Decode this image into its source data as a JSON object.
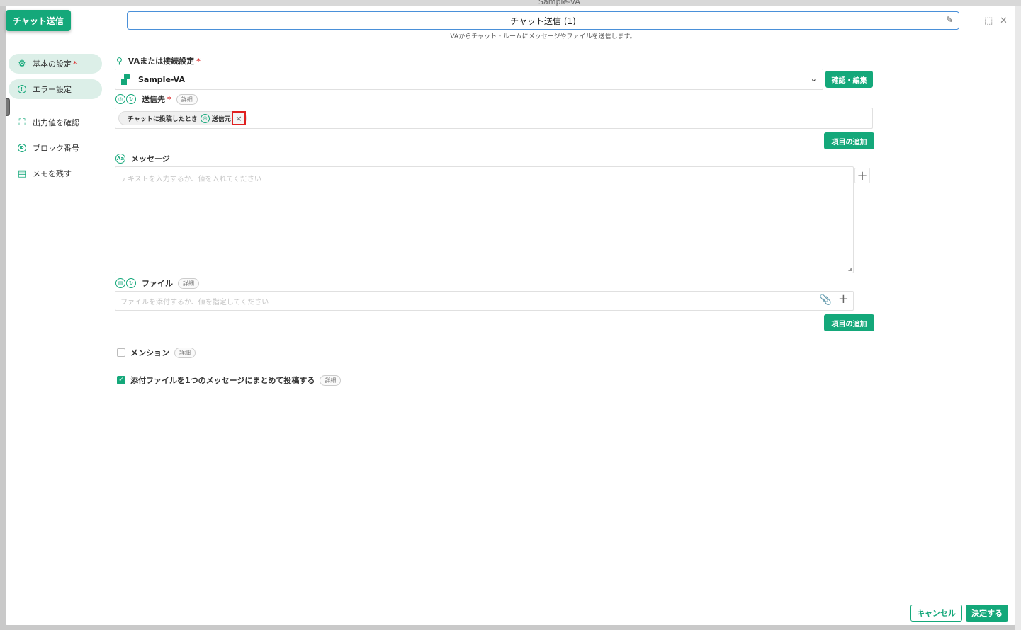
{
  "background": {
    "label": "Sample-VA"
  },
  "modal": {
    "block_badge": "チャット送信",
    "title": "チャット送信 (1)",
    "subtitle": "VAからチャット・ルームにメッセージやファイルを送信します。"
  },
  "sidebar": {
    "items": [
      {
        "label": "基本の設定",
        "required_mark": "*",
        "icon": "gear-icon"
      },
      {
        "label": "エラー設定",
        "icon": "alert-circle-icon"
      },
      {
        "label": "出力値を確認",
        "icon": "brackets-icon"
      },
      {
        "label": "ブロック番号",
        "icon": "id-circle-icon"
      },
      {
        "label": "メモを残す",
        "icon": "note-icon"
      }
    ]
  },
  "form": {
    "va_setting": {
      "label": "VAまたは接続設定",
      "required_mark": "*",
      "selected": "Sample-VA",
      "confirm_button": "確認・編集"
    },
    "destination": {
      "label": "送信先",
      "required_mark": "*",
      "detail_pill": "詳細",
      "chip_label": "チャットに投稿したとき",
      "chip_value": "送信元",
      "chip_remove": "×",
      "add_button": "項目の追加"
    },
    "message": {
      "label": "メッセージ",
      "placeholder": "テキストを入力するか、値を入れてください",
      "plus": "+"
    },
    "file": {
      "label": "ファイル",
      "detail_pill": "詳細",
      "placeholder": "ファイルを添付するか、値を指定してください",
      "plus": "+",
      "add_button": "項目の追加"
    },
    "mention": {
      "label": "メンション",
      "detail_pill": "詳細",
      "checked": false
    },
    "bundle_attachments": {
      "label": "添付ファイルを1つのメッセージにまとめて投稿する",
      "detail_pill": "詳細",
      "checked": true
    }
  },
  "footer": {
    "cancel": "キャンセル",
    "submit": "決定する"
  },
  "colors": {
    "accent": "#14a87a",
    "error": "#e02020",
    "focus": "#4a90d9"
  }
}
